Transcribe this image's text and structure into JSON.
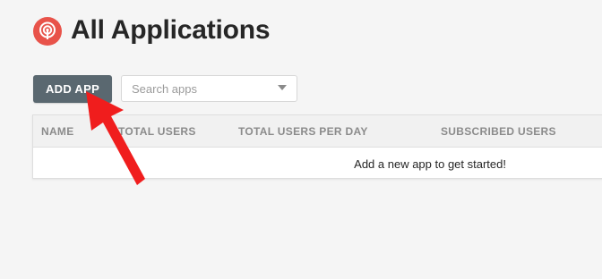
{
  "page": {
    "title": "All Applications",
    "logo_icon": "broadcast-icon",
    "brand_color": "#e8534a"
  },
  "toolbar": {
    "add_app_label": "ADD APP",
    "search_placeholder": "Search apps",
    "search_value": ""
  },
  "table": {
    "columns": [
      "NAME",
      "TOTAL USERS",
      "TOTAL USERS PER DAY",
      "SUBSCRIBED USERS"
    ],
    "rows": [],
    "empty_message": "Add a new app to get started!"
  },
  "annotation": {
    "icon": "red-arrow-icon",
    "color": "#f01d1d"
  }
}
